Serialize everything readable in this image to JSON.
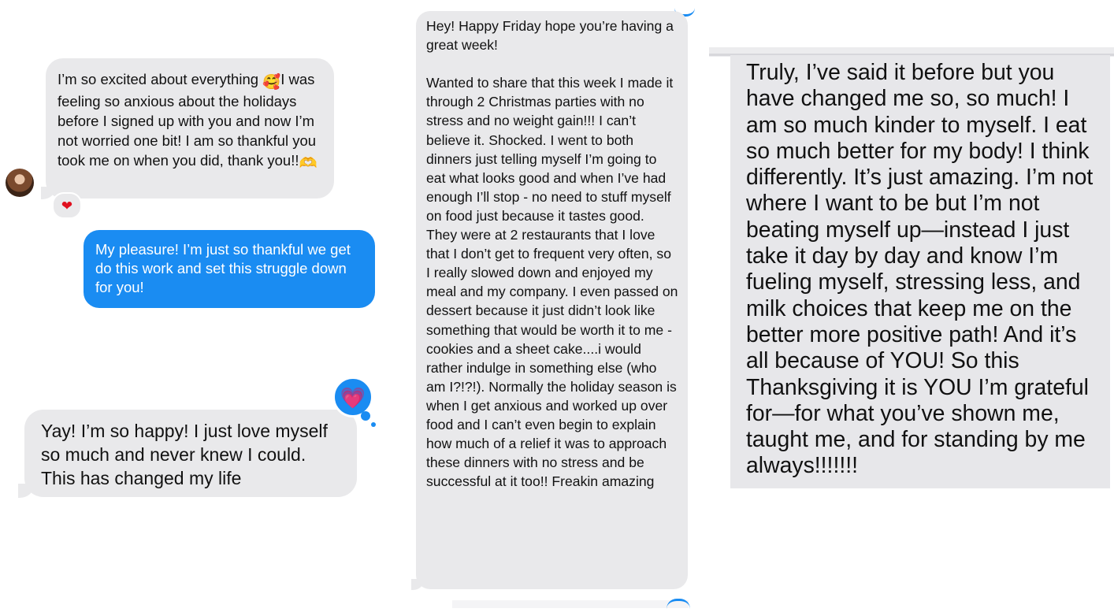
{
  "panel1": {
    "message1": {
      "text_before_emoji": "I’m so excited about everything ",
      "emoji1": "🥰",
      "text_after_emoji": "I was feeling so anxious about the holidays before I signed up with you and now I’m not worried one bit! I am so thankful you took me on when you did, thank you!!",
      "emoji2": "🫶",
      "reaction": "❤"
    },
    "reply": "My pleasure!  I’m just so thankful we get do this work and set this struggle down for you!",
    "message2": "Yay! I’m so happy! I just love myself so much and never knew I could. This has changed my life",
    "love_reaction": "💗"
  },
  "panel2": {
    "message": "Hey! Happy Friday hope you’re having a great week!\n\nWanted to share that this week I made it through 2 Christmas parties with no stress and no weight gain!!! I can’t believe it. Shocked. I went to both dinners just telling myself I’m going to eat what looks good and when I’ve had enough I’ll stop - no need to stuff myself on food just because it tastes good. They were at 2 restaurants that I love that I don’t get to frequent very often, so I really slowed down and enjoyed my meal and my company. I even passed on dessert because it just didn’t look like something that would be worth it to me - cookies and a sheet cake....i would rather indulge in something else (who am I?!?!). Normally the holiday season is when I get anxious and worked up over food and I can’t even begin to explain how much of a relief it was to approach these dinners with no stress and be successful at it too!! Freakin amazing"
  },
  "panel3": {
    "message": "Truly, I’ve said it before but you have changed me so, so much! I am so much kinder to myself. I eat so much better for my body! I think differently. It’s just amazing. I’m not where I want to be but I’m not beating myself up—instead I just take it day by day and know I’m fueling myself, stressing less, and milk choices that keep me on the better more positive path!  And it’s all because of YOU!  So this Thanksgiving it is YOU I’m grateful for—for what you’ve shown me, taught me, and for standing by me always!!!!!!!"
  },
  "colors": {
    "incoming_bubble": "#e9e9eb",
    "outgoing_bubble": "#1a8cf2",
    "heart_red": "#e0101f"
  }
}
